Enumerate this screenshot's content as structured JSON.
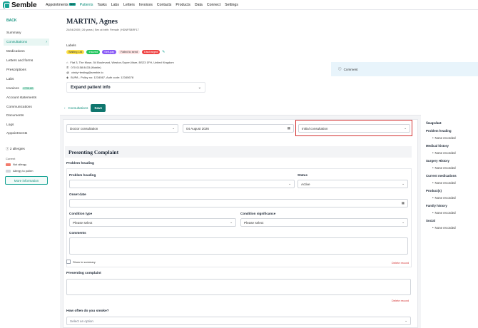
{
  "app": {
    "name": "Semble"
  },
  "nav": {
    "items": [
      "Appointments",
      "Patients",
      "Tasks",
      "Labs",
      "Letters",
      "Invoices",
      "Contacts",
      "Products",
      "Data",
      "Connect",
      "Settings"
    ],
    "new_badge": "NEW",
    "active": "Patients"
  },
  "sidebar": {
    "back": "BACK",
    "items": [
      "Summary",
      "Consultations",
      "Medications",
      "Letters and forms",
      "Prescriptions",
      "Labs",
      "Invoices",
      "Account statements",
      "Communications",
      "Documents",
      "Logs",
      "Appointments"
    ],
    "active": "Consultations",
    "invoice_badge": "£700.80",
    "allergy_count": "2 allergies",
    "allergy_sub": "Current",
    "allergies": [
      {
        "label": "Nut allergy",
        "color": "#f27b6c"
      },
      {
        "label": "Allergy to pollen",
        "color": "#d1d5db"
      }
    ],
    "more_info": "More information"
  },
  "patient": {
    "name": "MARTIN, Agnes",
    "meta": "24/04/2000 | 26 years | Sex at birth: Female | HDNFSBRF17",
    "labels_title": "Labels",
    "labels": [
      {
        "text": "Waiting List",
        "bg": "#fde047",
        "fg": "#333"
      },
      {
        "text": "Insured",
        "bg": "#22c55e",
        "fg": "#fff"
      },
      {
        "text": "Self-pay",
        "bg": "#8b5cf6",
        "fg": "#fff"
      },
      {
        "text": "Failed to send",
        "bg": "#fde2e2",
        "fg": "#333"
      },
      {
        "text": "Discharged",
        "bg": "#ef4444",
        "fg": "#fff"
      }
    ],
    "address": "Flat 3, The Muse, 54 Boulevard, Weston-Super-Mare, BS23 1FH, United Kingdom",
    "phone": "070 0158 8433 (Mobile)",
    "email": "cindy+testing@semble.io",
    "insurance": "BUPA - Policy no: 1234567, Auth code: 12345678",
    "expand": "Expand patient info"
  },
  "comment": "Comment",
  "breadcrumb": {
    "link": "Consultations",
    "save": "Save"
  },
  "form": {
    "consultation_type": "Doctor consultation",
    "date": "04 August 2026",
    "consult_stage": "Initial consultation",
    "section_title": "Presenting Complaint",
    "problem_heading_group": "Problem heading",
    "problem_heading_label": "Problem heading",
    "status_label": "Status",
    "status_value": "Active",
    "onset_label": "Onset date",
    "cond_type_label": "Condition type",
    "cond_type_value": "Please select",
    "cond_sig_label": "Condition significance",
    "cond_sig_value": "Please select",
    "comments_label": "Comments",
    "show_summary": "Show in summary",
    "delete_record": "Delete record",
    "presenting_label": "Presenting complaint",
    "smoke_label": "How often do you smoke?",
    "smoke_value": "Select an option"
  },
  "snapshot": {
    "title": "Snapshot",
    "items": [
      {
        "heading": "Problem heading",
        "value": "None recorded"
      },
      {
        "heading": "Medical history",
        "value": "None recorded"
      },
      {
        "heading": "Surgery History",
        "value": "None recorded"
      },
      {
        "heading": "Current medications",
        "value": "None recorded"
      },
      {
        "heading": "Product(s)",
        "value": "None recorded"
      },
      {
        "heading": "Family history",
        "value": "None recorded"
      },
      {
        "heading": "Social",
        "value": "None recorded"
      }
    ]
  }
}
